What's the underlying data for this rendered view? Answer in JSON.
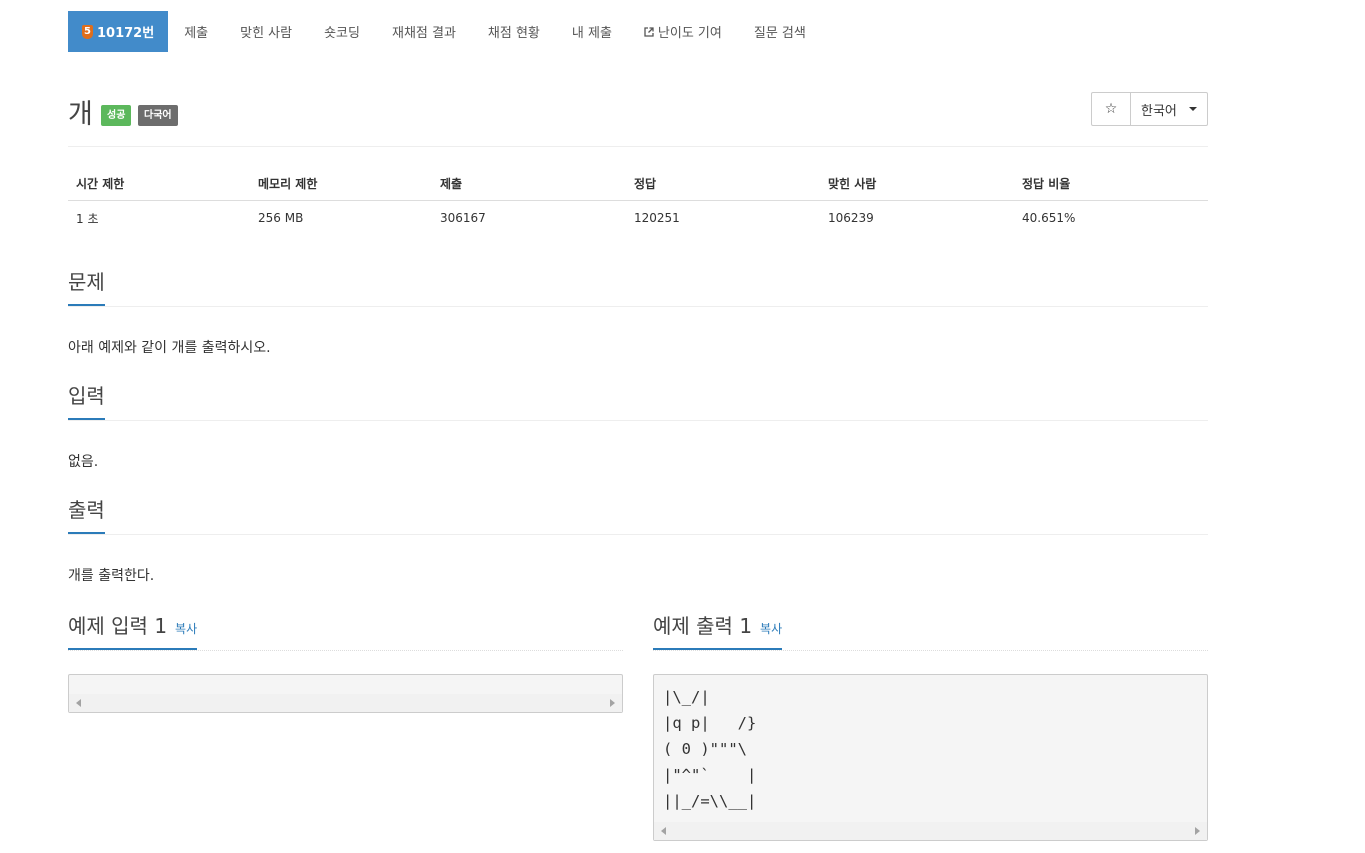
{
  "nav": {
    "problem_tier": "5",
    "problem_label": "10172번",
    "items": [
      "제출",
      "맞힌 사람",
      "숏코딩",
      "재채점 결과",
      "채점 현황",
      "내 제출",
      "난이도 기여",
      "질문 검색"
    ]
  },
  "problem": {
    "title": "개",
    "badges": [
      "성공",
      "다국어"
    ],
    "star": "☆",
    "language": "한국어"
  },
  "info": {
    "headers": [
      "시간 제한",
      "메모리 제한",
      "제출",
      "정답",
      "맞힌 사람",
      "정답 비율"
    ],
    "values": [
      "1 초",
      "256 MB",
      "306167",
      "120251",
      "106239",
      "40.651%"
    ]
  },
  "sections": {
    "problem_heading": "문제",
    "problem_text": "아래 예제와 같이 개를 출력하시오.",
    "input_heading": "입력",
    "input_text": "없음.",
    "output_heading": "출력",
    "output_text": "개를 출력한다."
  },
  "examples": {
    "input_heading": "예제 입력 1",
    "output_heading": "예제 출력 1",
    "copy_label": "복사",
    "input_content": "",
    "output_content": "|\\_/|\n|q p|   /}\n( 0 )\"\"\"\\\n|\"^\"`    |\n||_/=\\\\__|"
  },
  "colors": {
    "primary": "#428bca",
    "success": "#5cb85c",
    "accent": "#2b7bb9",
    "tier": "#e06e1b"
  }
}
